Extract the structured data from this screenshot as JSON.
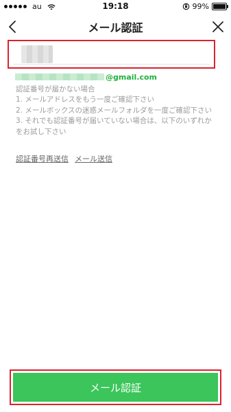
{
  "status_bar": {
    "carrier": "au",
    "time": "19:18",
    "battery": "99%",
    "battery_level": 0.99
  },
  "nav": {
    "title": "メール認証"
  },
  "code_field": {
    "value": "",
    "placeholder": ""
  },
  "email": {
    "domain": "@gmail.com"
  },
  "help": {
    "heading": "認証番号が届かない場合",
    "line1": "1. メールアドレスをもう一度ご確認下さい",
    "line2": "2. メールボックスの迷惑メールフォルダを一度ご確認下さい",
    "line3": "3. それでも認証番号が届いていない場合は、以下のいずれかをお試し下さい"
  },
  "links": {
    "resend_code": "認証番号再送信",
    "resend_email": "メール送信"
  },
  "submit": {
    "label": "メール認証"
  },
  "colors": {
    "accent_green": "#3bc55a",
    "highlight_red": "#d9232e",
    "email_green": "#1fb13a"
  }
}
